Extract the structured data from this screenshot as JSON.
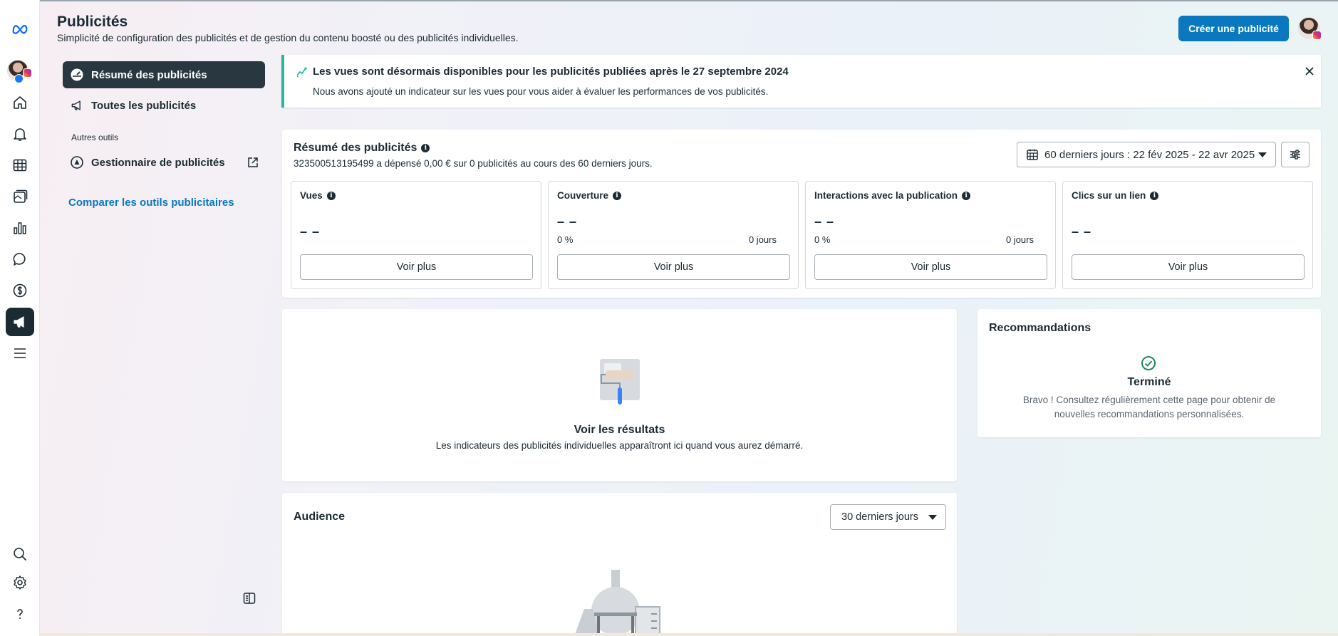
{
  "header": {
    "title": "Publicités",
    "subtitle": "Simplicité de configuration des publicités et de gestion du contenu boosté ou des publicités individuelles.",
    "create_button": "Créer une publicité"
  },
  "rail": {
    "icons": [
      "meta-logo-icon",
      "home-icon",
      "bell-icon",
      "table-icon",
      "content-icon",
      "insights-icon",
      "message-icon",
      "dollar-icon",
      "megaphone-icon",
      "menu-icon",
      "search-icon",
      "gear-icon",
      "help-icon"
    ],
    "active": "megaphone-icon"
  },
  "sidenav": {
    "items": [
      {
        "label": "Résumé des publicités",
        "active": true,
        "icon": "dashboard-icon"
      },
      {
        "label": "Toutes les publicités",
        "active": false,
        "icon": "megaphone-icon"
      }
    ],
    "section_label": "Autres outils",
    "tools": [
      {
        "label": "Gestionnaire de publicités",
        "icon": "ads-manager-icon"
      }
    ],
    "compare_link": "Comparer les outils publicitaires"
  },
  "banner": {
    "title": "Les vues sont désormais disponibles pour les publicités publiées après le 27 septembre 2024",
    "text": "Nous avons ajouté un indicateur sur les vues pour vous aider à évaluer les performances de vos publicités."
  },
  "summary": {
    "title": "Résumé des publicités",
    "info": "i",
    "description": "323500513195499 a dépensé 0,00 € sur 0 publicités au cours des 60 derniers jours.",
    "date_range": "60 derniers jours : 22 fév 2025 - 22 avr 2025",
    "metrics": [
      {
        "title": "Vues",
        "value": "– –",
        "pct": "",
        "days": "",
        "button": "Voir plus"
      },
      {
        "title": "Couverture",
        "value": "– –",
        "pct": "0 %",
        "days": "0 jours",
        "button": "Voir plus"
      },
      {
        "title": "Interactions avec la publication",
        "value": "– –",
        "pct": "0 %",
        "days": "0 jours",
        "button": "Voir plus"
      },
      {
        "title": "Clics sur un lien",
        "value": "– –",
        "pct": "",
        "days": "",
        "button": "Voir plus"
      }
    ]
  },
  "results": {
    "title": "Voir les résultats",
    "text": "Les indicateurs des publicités individuelles apparaîtront ici quand vous aurez démarré."
  },
  "recommendations": {
    "title": "Recommandations",
    "status": "Terminé",
    "text": "Bravo ! Consultez régulièrement cette page pour obtenir de nouvelles recommandations personnalisées."
  },
  "audience": {
    "title": "Audience",
    "range": "30 derniers jours"
  },
  "colors": {
    "primary": "#0a78be",
    "active_nav": "#293740",
    "banner_accent": "#2ab4a2",
    "text": "#1c2b33"
  }
}
